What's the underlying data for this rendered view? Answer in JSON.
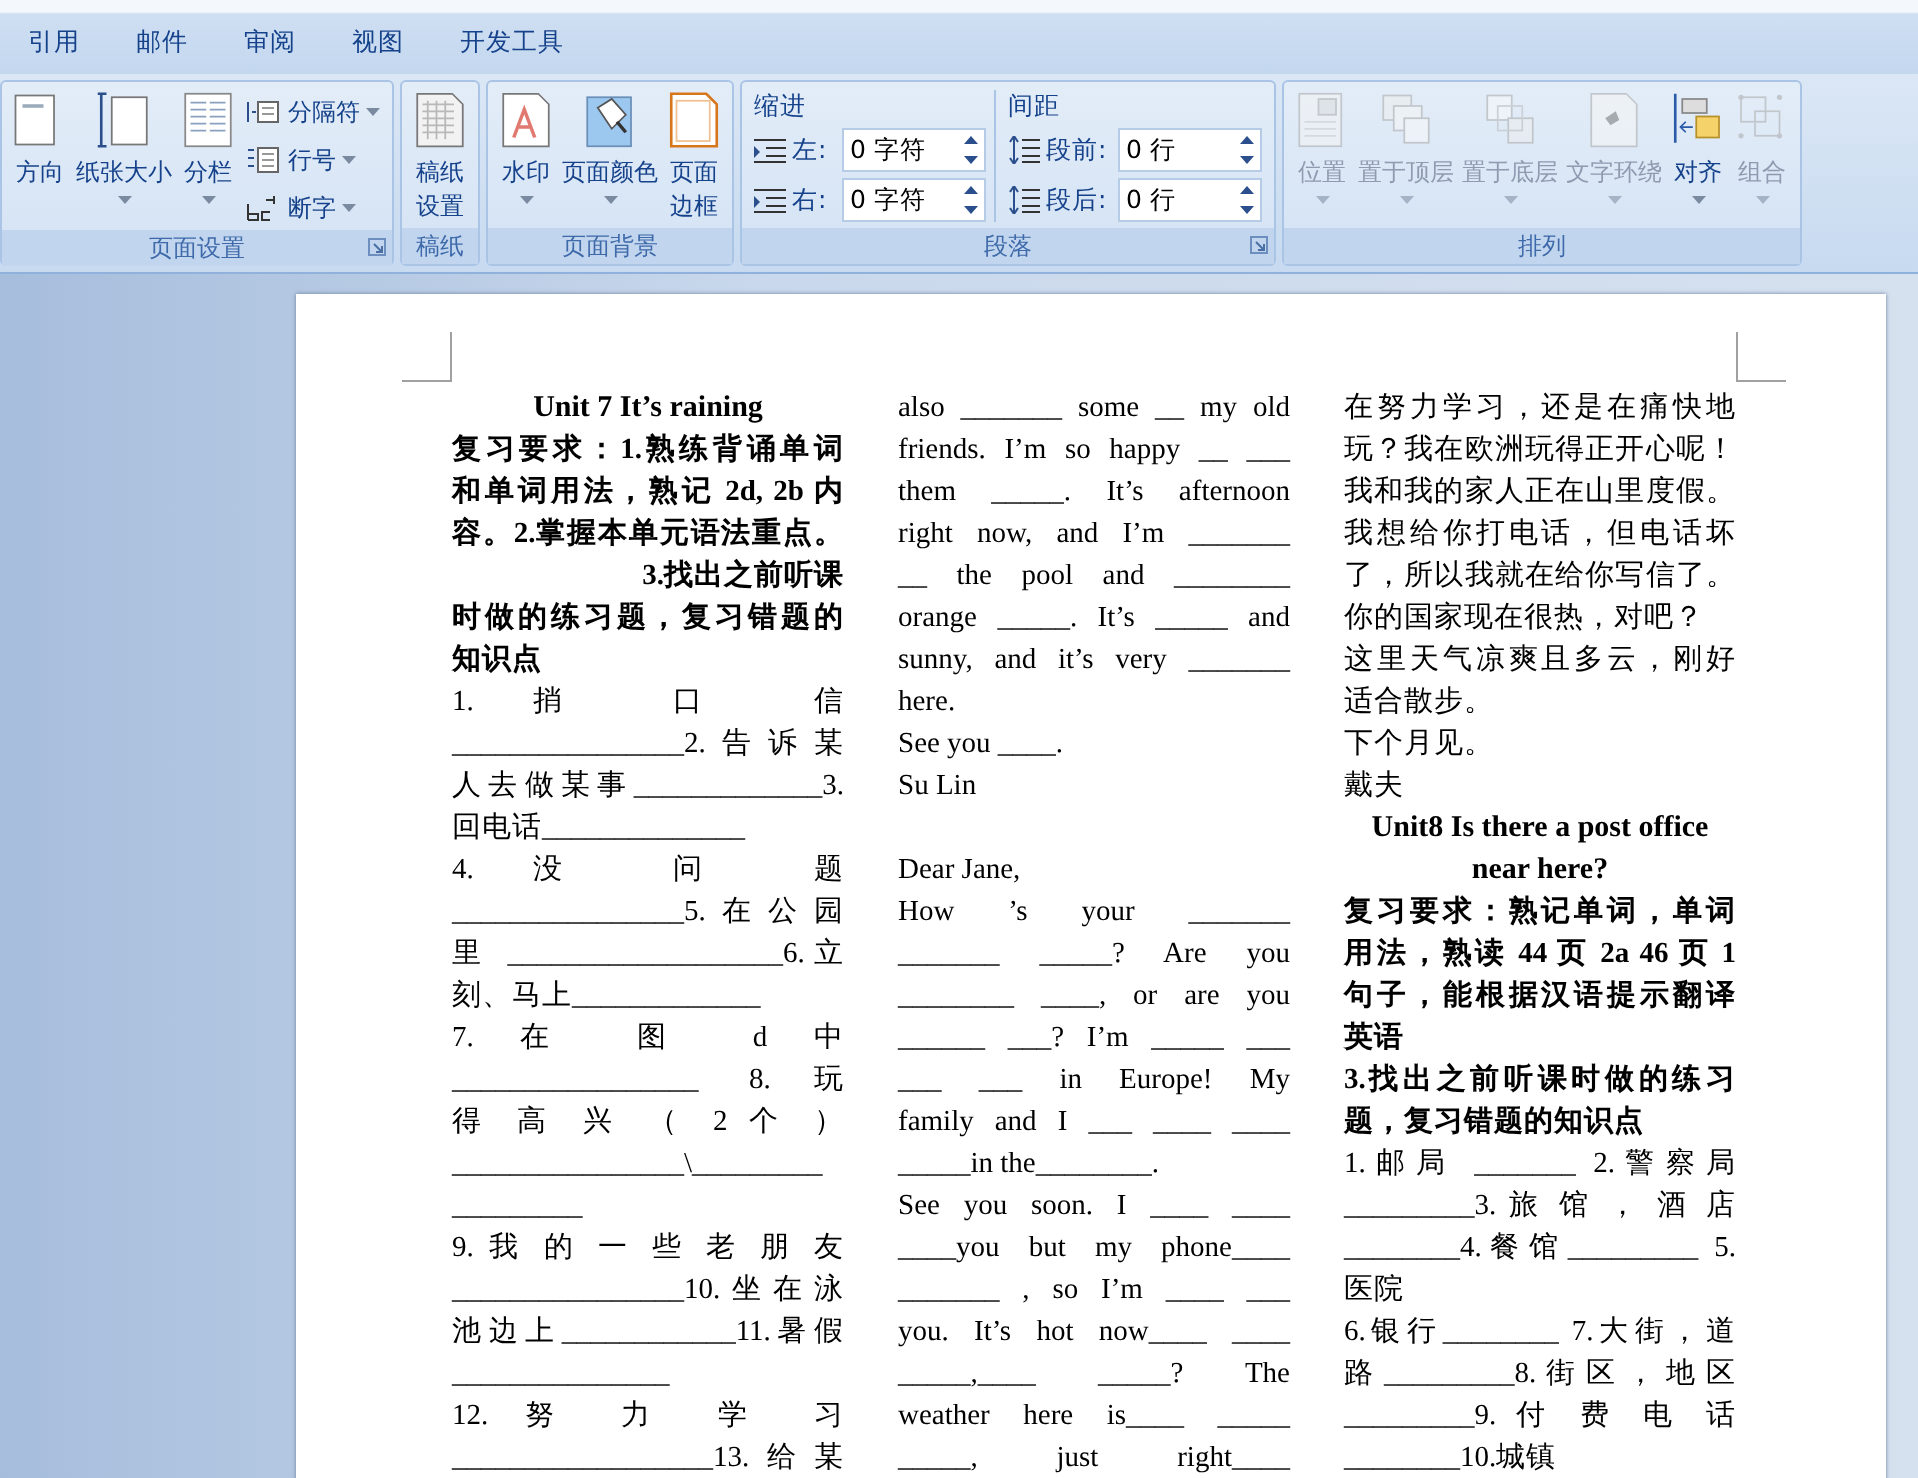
{
  "tabs": [
    {
      "label": "引用"
    },
    {
      "label": "邮件"
    },
    {
      "label": "审阅"
    },
    {
      "label": "视图"
    },
    {
      "label": "开发工具"
    }
  ],
  "ribbon": {
    "groups": [
      {
        "label": "页面设置",
        "launcher": true,
        "controls": [
          {
            "kind": "large",
            "label": "方向",
            "dropdown": false,
            "disabled": false
          },
          {
            "kind": "large",
            "label": "纸张大小",
            "dropdown": true,
            "disabled": false
          },
          {
            "kind": "large",
            "label": "分栏",
            "dropdown": true,
            "disabled": false
          },
          {
            "kind": "stack",
            "items": [
              {
                "label": "分隔符",
                "dropdown": true
              },
              {
                "label": "行号",
                "dropdown": true
              },
              {
                "label": "断字",
                "dropdown": true
              }
            ]
          }
        ]
      },
      {
        "label": "稿纸",
        "launcher": false,
        "controls": [
          {
            "kind": "tall",
            "label": "稿纸设置",
            "dropdown": false,
            "disabled": false
          }
        ]
      },
      {
        "label": "页面背景",
        "launcher": false,
        "controls": [
          {
            "kind": "large",
            "label": "水印",
            "dropdown": true,
            "disabled": false
          },
          {
            "kind": "large",
            "label": "页面颜色",
            "dropdown": true,
            "disabled": false
          },
          {
            "kind": "tall",
            "label": "页面边框",
            "dropdown": false,
            "disabled": false
          }
        ]
      },
      {
        "label": "段落",
        "launcher": true,
        "controls": [
          {
            "kind": "spin",
            "title": "缩进",
            "fields": [
              {
                "label": "左:",
                "value": "0 字符"
              },
              {
                "label": "右:",
                "value": "0 字符"
              }
            ]
          },
          {
            "kind": "spin",
            "title": "间距",
            "fields": [
              {
                "label": "段前:",
                "value": "0 行"
              },
              {
                "label": "段后:",
                "value": "0 行"
              }
            ]
          }
        ]
      },
      {
        "label": "排列",
        "launcher": false,
        "controls": [
          {
            "kind": "large",
            "label": "位置",
            "dropdown": true,
            "disabled": true
          },
          {
            "kind": "large",
            "label": "置于顶层",
            "dropdown": true,
            "disabled": true
          },
          {
            "kind": "large",
            "label": "置于底层",
            "dropdown": true,
            "disabled": true
          },
          {
            "kind": "large",
            "label": "文字环绕",
            "dropdown": true,
            "disabled": true
          },
          {
            "kind": "large",
            "label": "对齐",
            "dropdown": true,
            "disabled": false
          },
          {
            "kind": "large",
            "label": "组合",
            "dropdown": true,
            "disabled": true
          }
        ]
      }
    ]
  },
  "document": {
    "columns": [
      {
        "lines": [
          {
            "kind": "heading",
            "text": "Unit 7 It’s raining"
          },
          {
            "kind": "bold",
            "text": "复习要求：1.熟练背诵单词"
          },
          {
            "kind": "bold",
            "text": "和单词用法，熟记 2d, 2b 内"
          },
          {
            "kind": "bold",
            "text": "容。2.掌握本单元语法重点。"
          },
          {
            "kind": "boldright",
            "text": "3.找出之前听课"
          },
          {
            "kind": "bold",
            "text": "时做的练习题，复习错题的"
          },
          {
            "kind": "boldleft",
            "text": "知识点"
          },
          {
            "kind": "justified",
            "text": "1. 捎 口 信"
          },
          {
            "kind": "justified",
            "text": "________________2.告诉某"
          },
          {
            "kind": "justified",
            "text": "人去做某事_____________3."
          },
          {
            "kind": "plain",
            "text": "回电话______________"
          },
          {
            "kind": "justified",
            "text": "4. 没 问 题"
          },
          {
            "kind": "justified",
            "text": "________________5.在公园"
          },
          {
            "kind": "justified",
            "text": "里 ___________________6.立"
          },
          {
            "kind": "plain",
            "text": "刻、马上_____________"
          },
          {
            "kind": "justified",
            "text": "7. 在 图 d 中"
          },
          {
            "kind": "justified",
            "text": "_________________ 8.玩"
          },
          {
            "kind": "justified",
            "text": "得 高 兴 （ 2 个 ）"
          },
          {
            "kind": "plain",
            "text": "________________\\_________"
          },
          {
            "kind": "plain",
            "text": "_________"
          },
          {
            "kind": "justified",
            "text": "9. 我 的 一 些 老 朋 友"
          },
          {
            "kind": "justified",
            "text": "________________10.坐在泳"
          },
          {
            "kind": "justified",
            "text": "池边上____________11.暑假"
          },
          {
            "kind": "plain",
            "text": "_______________"
          },
          {
            "kind": "justified",
            "text": "12. 努 力 学 习"
          },
          {
            "kind": "justified",
            "text": "__________________13.给某"
          }
        ]
      },
      {
        "lines": [
          {
            "kind": "justified",
            "text": "also _______ some __ my old"
          },
          {
            "kind": "justified",
            "text": "friends. I’m so happy __ ___"
          },
          {
            "kind": "justified",
            "text": "them _____. It’s afternoon"
          },
          {
            "kind": "justified",
            "text": "right now, and I’m _______"
          },
          {
            "kind": "justified",
            "text": "__ the pool and ________"
          },
          {
            "kind": "justified",
            "text": "orange _____. It’s _____ and"
          },
          {
            "kind": "justified",
            "text": "sunny, and it’s very _______"
          },
          {
            "kind": "plain",
            "text": "here."
          },
          {
            "kind": "plain",
            "text": "See you ____."
          },
          {
            "kind": "plain",
            "text": "Su Lin"
          },
          {
            "kind": "blank"
          },
          {
            "kind": "plain",
            "text": "Dear Jane,"
          },
          {
            "kind": "justified",
            "text": "How ’s your _______"
          },
          {
            "kind": "justified",
            "text": "_______ _____? Are you"
          },
          {
            "kind": "justified",
            "text": "________ ____, or are you"
          },
          {
            "kind": "justified",
            "text": "______ ___? I’m _____ ___"
          },
          {
            "kind": "justified",
            "text": "___ ___ in Europe! My"
          },
          {
            "kind": "justified",
            "text": "family and I ___ ____ ____"
          },
          {
            "kind": "plain",
            "text": "_____in the________."
          },
          {
            "kind": "justified",
            "text": "See you soon. I ____ ____"
          },
          {
            "kind": "justified",
            "text": "____you but my phone____"
          },
          {
            "kind": "justified",
            "text": "_______ , so I’m ____ ___"
          },
          {
            "kind": "justified",
            "text": "you. It’s hot now____ ____"
          },
          {
            "kind": "justified",
            "text": "_____,____ _____? The"
          },
          {
            "kind": "justified",
            "text": "weather here is____ _____"
          },
          {
            "kind": "justified",
            "text": "_____, just right____"
          }
        ]
      },
      {
        "lines": [
          {
            "kind": "justified",
            "text": "在努力学习，还是在痛快地"
          },
          {
            "kind": "justified",
            "text": "玩？我在欧洲玩得正开心呢！"
          },
          {
            "kind": "justified",
            "text": "我和我的家人正在山里度假。"
          },
          {
            "kind": "justified",
            "text": "我想给你打电话，但电话坏"
          },
          {
            "kind": "justified",
            "text": "了，所以我就在给你写信了。"
          },
          {
            "kind": "plain",
            "text": "你的国家现在很热，对吧？"
          },
          {
            "kind": "justified",
            "text": "这里天气凉爽且多云，刚好"
          },
          {
            "kind": "plain",
            "text": "适合散步。"
          },
          {
            "kind": "plain",
            "text": "下个月见。"
          },
          {
            "kind": "plain",
            "text": "戴夫"
          },
          {
            "kind": "heading",
            "text": "Unit8 Is there a post office"
          },
          {
            "kind": "heading",
            "text": "near here?"
          },
          {
            "kind": "bold",
            "text": "复习要求：熟记单词，单词"
          },
          {
            "kind": "bold",
            "text": "用法，熟读 44 页 2a 46 页 1"
          },
          {
            "kind": "bold",
            "text": "句子，能根据汉语提示翻译"
          },
          {
            "kind": "boldleft",
            "text": "英语"
          },
          {
            "kind": "bold",
            "text": "3.找出之前听课时做的练习"
          },
          {
            "kind": "boldleft",
            "text": "题，复习错题的知识点"
          },
          {
            "kind": "justified",
            "text": "1.邮局 _______ 2.警察局"
          },
          {
            "kind": "justified",
            "text": "_________3. 旅 馆 ， 酒 店"
          },
          {
            "kind": "justified",
            "text": "________4.餐馆_________ 5."
          },
          {
            "kind": "plain",
            "text": "医院"
          },
          {
            "kind": "justified",
            "text": "6.银行________ 7.大街，道"
          },
          {
            "kind": "justified",
            "text": "路_________8.街区，地区"
          },
          {
            "kind": "justified",
            "text": "_________9. 付 费 电 话"
          },
          {
            "kind": "plain",
            "text": "________10.城镇"
          }
        ]
      }
    ]
  }
}
